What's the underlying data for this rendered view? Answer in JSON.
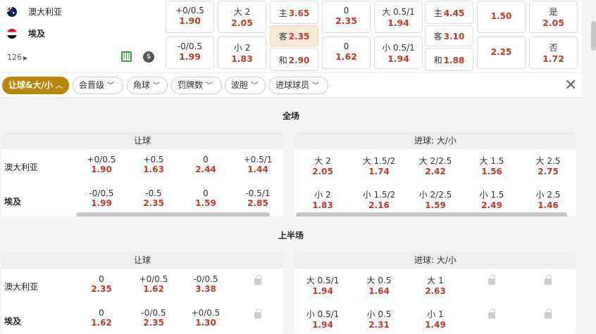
{
  "match": {
    "home": "澳大利亚",
    "away": "埃及",
    "count": "126",
    "dollar_symbol": "$"
  },
  "top_markets": [
    {
      "label": "+0/0.5",
      "odds": "1.90"
    },
    {
      "label": "大 2",
      "odds": "2.05"
    },
    {
      "label": "主",
      "odds": "3.65"
    },
    {
      "label": "0",
      "odds": "2.35"
    },
    {
      "label": "大 0.5/1",
      "odds": "1.94"
    },
    {
      "label": "主",
      "odds": "4.45"
    },
    {
      "label": "",
      "odds": "1.50"
    },
    {
      "label": "是",
      "odds": "2.05"
    },
    {
      "label": "-0/0.5",
      "odds": "1.99"
    },
    {
      "label": "小 2",
      "odds": "1.83"
    },
    {
      "label": "客",
      "odds": "2.35"
    },
    {
      "label": "0",
      "odds": "1.62"
    },
    {
      "label": "小 0.5/1",
      "odds": "1.94"
    },
    {
      "label": "客",
      "odds": "3.10"
    },
    {
      "label": "",
      "odds": "2.25"
    },
    {
      "label": "否",
      "odds": "1.72"
    },
    {
      "label": "和",
      "odds": "2.90"
    },
    {
      "label": "和",
      "odds": "1.88"
    }
  ],
  "filters": [
    {
      "label": "让球&大/小"
    },
    {
      "label": "会晋级"
    },
    {
      "label": "角球"
    },
    {
      "label": "罚牌数"
    },
    {
      "label": "波胆"
    },
    {
      "label": "进球球员"
    }
  ],
  "sections": [
    {
      "title": "全场",
      "handicap": {
        "header": "让球",
        "rows": [
          {
            "team": "澳大利亚",
            "cells": [
              {
                "l": "+0/0.5",
                "o": "1.90"
              },
              {
                "l": "+0.5",
                "o": "1.63"
              },
              {
                "l": "0",
                "o": "2.44"
              },
              {
                "l": "+0.5/1",
                "o": "1.44"
              }
            ]
          },
          {
            "team": "埃及",
            "cells": [
              {
                "l": "-0/0.5",
                "o": "1.99"
              },
              {
                "l": "-0.5",
                "o": "2.35"
              },
              {
                "l": "0",
                "o": "1.59"
              },
              {
                "l": "-0.5/1",
                "o": "2.85"
              }
            ]
          }
        ]
      },
      "totals": {
        "header": "进球: 大/小",
        "rows": [
          {
            "cells": [
              {
                "l": "大 2",
                "o": "2.05"
              },
              {
                "l": "大 1.5/2",
                "o": "1.74"
              },
              {
                "l": "大 2/2.5",
                "o": "2.42"
              },
              {
                "l": "大 1.5",
                "o": "1.56"
              },
              {
                "l": "大 2.5",
                "o": "2.75"
              }
            ]
          },
          {
            "cells": [
              {
                "l": "小 2",
                "o": "1.83"
              },
              {
                "l": "小 1.5/2",
                "o": "2.16"
              },
              {
                "l": "小 2/2.5",
                "o": "1.59"
              },
              {
                "l": "小 1.5",
                "o": "2.49"
              },
              {
                "l": "小 2.5",
                "o": "1.46"
              }
            ]
          }
        ]
      }
    },
    {
      "title": "上半场",
      "handicap": {
        "header": "让球",
        "rows": [
          {
            "team": "澳大利亚",
            "cells": [
              {
                "l": "0",
                "o": "2.35"
              },
              {
                "l": "+0/0.5",
                "o": "1.62"
              },
              {
                "l": "-0/0.5",
                "o": "3.38"
              },
              {
                "lock": true
              }
            ]
          },
          {
            "team": "埃及",
            "cells": [
              {
                "l": "0",
                "o": "1.62"
              },
              {
                "l": "-0/0.5",
                "o": "2.35"
              },
              {
                "l": "+0/0.5",
                "o": "1.30"
              },
              {
                "lock": true
              }
            ]
          }
        ]
      },
      "totals": {
        "header": "进球: 大/小",
        "rows": [
          {
            "cells": [
              {
                "l": "大 0.5/1",
                "o": "1.94"
              },
              {
                "l": "大 0.5",
                "o": "1.64"
              },
              {
                "l": "大 1",
                "o": "2.63"
              },
              {
                "lock": true
              },
              {
                "lock": true
              }
            ]
          },
          {
            "cells": [
              {
                "l": "小 0.5/1",
                "o": "1.94"
              },
              {
                "l": "小 0.5",
                "o": "2.31"
              },
              {
                "l": "小 1",
                "o": "1.49"
              },
              {
                "lock": true
              },
              {
                "lock": true
              }
            ]
          }
        ]
      }
    }
  ],
  "colors": {
    "accent": "#b8860b",
    "odds": "#c0392b",
    "selected": "#f9e9d7"
  }
}
